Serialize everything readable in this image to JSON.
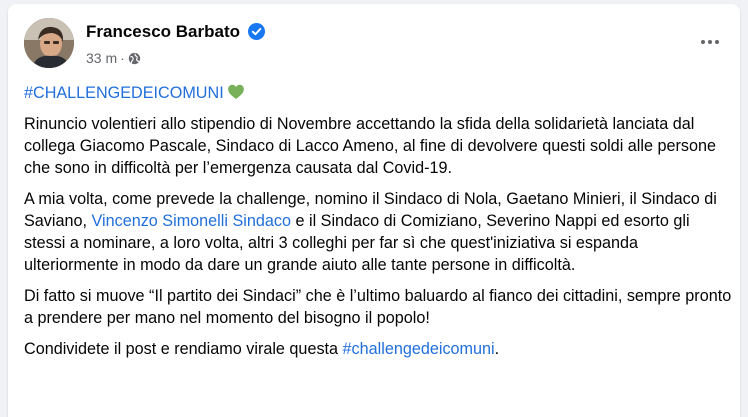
{
  "post": {
    "author": "Francesco Barbato",
    "time": "33 m",
    "separator": "·",
    "hashtag": "#CHALLENGEDEICOMUNI",
    "paragraph1": "Rinuncio volentieri allo stipendio di Novembre accettando la sfida della solidarietà lanciata dal collega Giacomo Pascale, Sindaco di Lacco Ameno, al fine di devolvere questi soldi alle persone che sono in difficoltà per l’emergenza causata dal Covid-19.",
    "paragraph2_part1": "A mia volta, come prevede la challenge, nomino il Sindaco di Nola, Gaetano Minieri, il Sindaco di Saviano, ",
    "paragraph2_mention": "Vincenzo Simonelli Sindaco",
    "paragraph2_part2": " e il Sindaco di Comiziano, Severino Nappi ed esorto gli stessi a nominare, a loro volta, altri 3 colleghi per far sì che quest'iniziativa si espanda ulteriormente in modo da dare un grande aiuto alle tante persone in difficoltà.",
    "paragraph3": "Di fatto si muove “Il partito dei Sindaci” che è l’ultimo baluardo al fianco dei cittadini, sempre pronto a prendere per mano nel momento del bisogno il popolo!",
    "paragraph4_part1": "Condividete il post e rendiamo virale questa ",
    "paragraph4_hashtag": "#challengedeicomuni",
    "paragraph4_part2": "."
  },
  "icons": {
    "verified": "verified-badge-icon",
    "audience": "globe-icon",
    "more": "more-options-icon",
    "heart": "green-heart-icon"
  },
  "colors": {
    "link": "#216fdb",
    "verified": "#1877f2",
    "heart": "#78b159",
    "meta_text": "#65676b"
  }
}
